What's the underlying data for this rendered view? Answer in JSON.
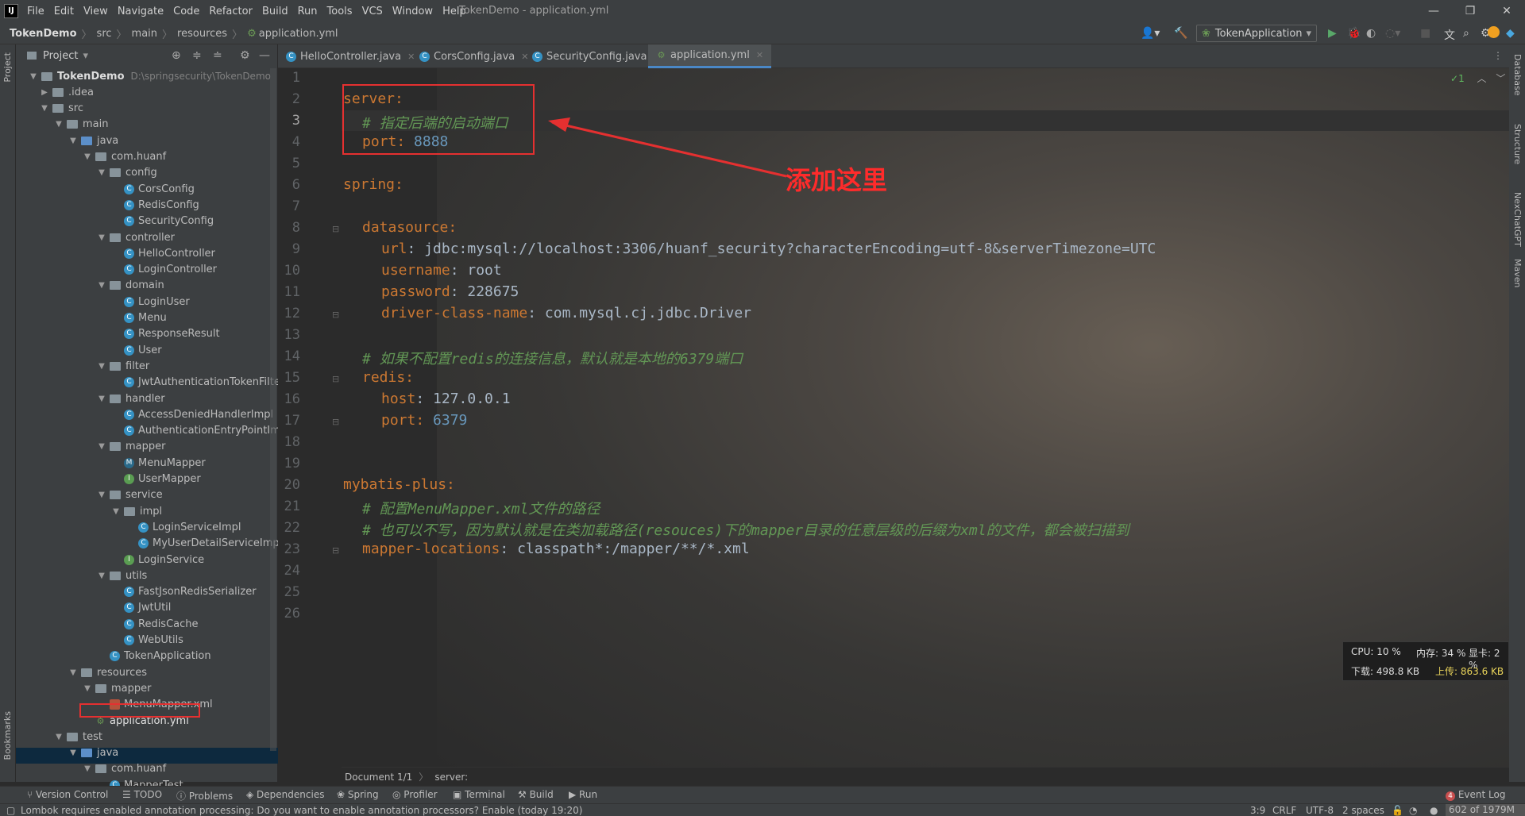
{
  "menu": [
    "File",
    "Edit",
    "View",
    "Navigate",
    "Code",
    "Refactor",
    "Build",
    "Run",
    "Tools",
    "VCS",
    "Window",
    "Help"
  ],
  "window_title": "TokenDemo - application.yml",
  "breadcrumbs": [
    "TokenDemo",
    "src",
    "main",
    "resources",
    "application.yml"
  ],
  "run_config": "TokenApplication",
  "project_panel": {
    "title": "Project",
    "root_name": "TokenDemo",
    "root_path": "D:\\springsecurity\\TokenDemo"
  },
  "tree": [
    {
      "depth": 0,
      "arrow": "v",
      "icon": "folder",
      "label": ".idea",
      "closed": true
    },
    {
      "depth": 0,
      "arrow": "v",
      "icon": "folder",
      "label": "src"
    },
    {
      "depth": 1,
      "arrow": "v",
      "icon": "folder",
      "label": "main"
    },
    {
      "depth": 2,
      "arrow": "v",
      "icon": "src",
      "label": "java"
    },
    {
      "depth": 3,
      "arrow": "v",
      "icon": "folder",
      "label": "com.huanf"
    },
    {
      "depth": 4,
      "arrow": "v",
      "icon": "folder",
      "label": "config"
    },
    {
      "depth": 5,
      "icon": "class",
      "label": "CorsConfig"
    },
    {
      "depth": 5,
      "icon": "class",
      "label": "RedisConfig"
    },
    {
      "depth": 5,
      "icon": "class",
      "label": "SecurityConfig"
    },
    {
      "depth": 4,
      "arrow": "v",
      "icon": "folder",
      "label": "controller"
    },
    {
      "depth": 5,
      "icon": "class",
      "label": "HelloController"
    },
    {
      "depth": 5,
      "icon": "class",
      "label": "LoginController"
    },
    {
      "depth": 4,
      "arrow": "v",
      "icon": "folder",
      "label": "domain"
    },
    {
      "depth": 5,
      "icon": "class",
      "label": "LoginUser"
    },
    {
      "depth": 5,
      "icon": "class",
      "label": "Menu"
    },
    {
      "depth": 5,
      "icon": "class",
      "label": "ResponseResult"
    },
    {
      "depth": 5,
      "icon": "class",
      "label": "User"
    },
    {
      "depth": 4,
      "arrow": "v",
      "icon": "folder",
      "label": "filter"
    },
    {
      "depth": 5,
      "icon": "class",
      "label": "JwtAuthenticationTokenFilter"
    },
    {
      "depth": 4,
      "arrow": "v",
      "icon": "folder",
      "label": "handler"
    },
    {
      "depth": 5,
      "icon": "class",
      "label": "AccessDeniedHandlerImpl"
    },
    {
      "depth": 5,
      "icon": "class",
      "label": "AuthenticationEntryPointImp"
    },
    {
      "depth": 4,
      "arrow": "v",
      "icon": "folder",
      "label": "mapper"
    },
    {
      "depth": 5,
      "icon": "mapper",
      "label": "MenuMapper"
    },
    {
      "depth": 5,
      "icon": "iface",
      "label": "UserMapper"
    },
    {
      "depth": 4,
      "arrow": "v",
      "icon": "folder",
      "label": "service"
    },
    {
      "depth": 5,
      "arrow": "v",
      "icon": "folder",
      "label": "impl"
    },
    {
      "depth": 6,
      "icon": "class",
      "label": "LoginServiceImpl"
    },
    {
      "depth": 6,
      "icon": "class",
      "label": "MyUserDetailServiceImpl"
    },
    {
      "depth": 5,
      "icon": "iface",
      "label": "LoginService"
    },
    {
      "depth": 4,
      "arrow": "v",
      "icon": "folder",
      "label": "utils"
    },
    {
      "depth": 5,
      "icon": "class",
      "label": "FastJsonRedisSerializer"
    },
    {
      "depth": 5,
      "icon": "class",
      "label": "JwtUtil"
    },
    {
      "depth": 5,
      "icon": "class",
      "label": "RedisCache"
    },
    {
      "depth": 5,
      "icon": "class",
      "label": "WebUtils"
    },
    {
      "depth": 4,
      "icon": "class",
      "label": "TokenApplication"
    },
    {
      "depth": 2,
      "arrow": "v",
      "icon": "folder",
      "label": "resources"
    },
    {
      "depth": 3,
      "arrow": "v",
      "icon": "folder",
      "label": "mapper"
    },
    {
      "depth": 4,
      "icon": "xml",
      "label": "MenuMapper.xml"
    },
    {
      "depth": 3,
      "icon": "yml",
      "label": "application.yml"
    },
    {
      "depth": 1,
      "arrow": "v",
      "icon": "folder",
      "label": "test"
    },
    {
      "depth": 2,
      "arrow": "v",
      "icon": "src",
      "label": "java"
    },
    {
      "depth": 3,
      "arrow": "v",
      "icon": "folder",
      "label": "com.huanf"
    },
    {
      "depth": 4,
      "icon": "class",
      "label": "MapperTest"
    }
  ],
  "tabs": [
    {
      "label": "HelloController.java",
      "icon": "C"
    },
    {
      "label": "CorsConfig.java",
      "icon": "C"
    },
    {
      "label": "SecurityConfig.java",
      "icon": "C"
    },
    {
      "label": "application.yml",
      "icon": "yml",
      "active": true
    }
  ],
  "line_numbers": [
    "1",
    "2",
    "3",
    "4",
    "5",
    "6",
    "7",
    "8",
    "9",
    "10",
    "11",
    "12",
    "13",
    "14",
    "15",
    "16",
    "17",
    "18",
    "19",
    "20",
    "21",
    "22",
    "23",
    "24",
    "25",
    "26"
  ],
  "code": {
    "l2": "server:",
    "l3": "# 指定后端的启动端口",
    "l4_key": "port: ",
    "l4_val": "8888",
    "l6": "spring:",
    "l8": "datasource:",
    "l9_key": "url",
    "l9_val": ": jdbc:mysql://localhost:3306/huanf_security?characterEncoding=utf-8&serverTimezone=UTC",
    "l10_key": "username",
    "l10_val": ": root",
    "l11_key": "password",
    "l11_val": ": 228675",
    "l12_key": "driver-class-name",
    "l12_val": ": com.mysql.cj.jdbc.Driver",
    "l14": "# 如果不配置redis的连接信息，默认就是本地的6379端口",
    "l15": "redis:",
    "l16_key": "host",
    "l16_val": ": 127.0.0.1",
    "l17_key": "port: ",
    "l17_val": "6379",
    "l20": "mybatis-plus:",
    "l21": "# 配置MenuMapper.xml文件的路径",
    "l22": "# 也可以不写，因为默认就是在类加载路径(resouces)下的mapper目录的任意层级的后缀为xml的文件，都会被扫描到",
    "l23_key": "mapper-locations",
    "l23_val": ": classpath*:/mapper/**/*.xml"
  },
  "annotation": "添加这里",
  "inspection_count": "1",
  "editor_breadcrumb": [
    "Document 1/1",
    "server:"
  ],
  "sysmon": {
    "cpu": "CPU: 10 %",
    "mem": "内存: 34 %",
    "gpu": "显卡: 2 %",
    "down": "下载: 498.8 KB",
    "up": "上传: 863.6 KB"
  },
  "toolwindows": [
    "Version Control",
    "TODO",
    "Problems",
    "Dependencies",
    "Spring",
    "Profiler",
    "Terminal",
    "Build",
    "Run"
  ],
  "event_log": "Event Log",
  "event_count": "4",
  "status_message": "Lombok requires enabled annotation processing: Do you want to enable annotation processors? Enable (today 19:20)",
  "status_right": [
    "3:9",
    "CRLF",
    "UTF-8",
    "2 spaces"
  ],
  "memory": "602 of 1979M",
  "right_stripe": [
    "Database",
    "Structure",
    "NexChatGPT",
    "Maven"
  ],
  "left_stripe": [
    "Project",
    "Bookmarks"
  ]
}
